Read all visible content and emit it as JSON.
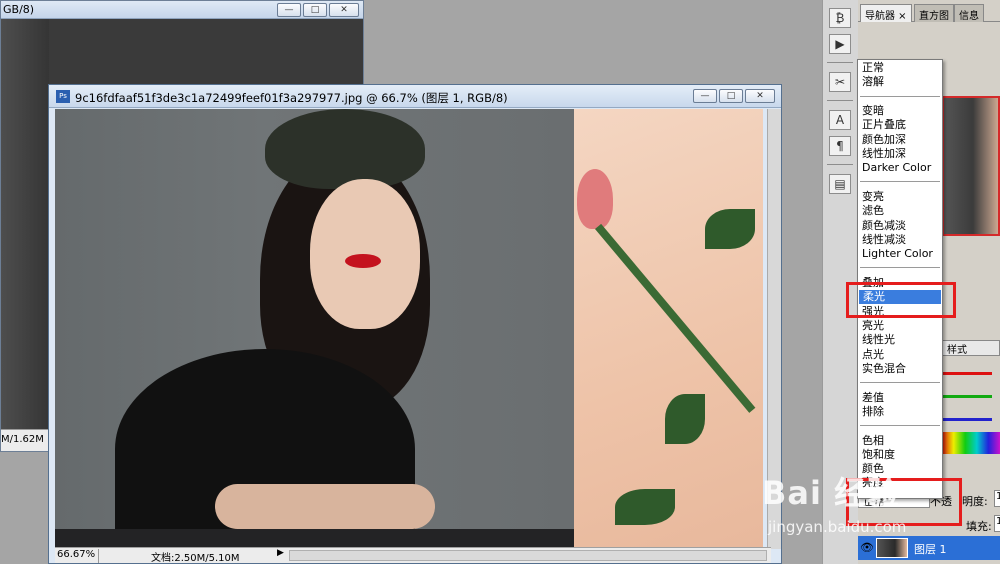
{
  "background_window": {
    "title_fragment": "GB/8)",
    "status_fragment": "M/1.62M"
  },
  "document": {
    "icon_label": "Ps",
    "title": "9c16fdfaaf51f3de3c1a72499feef01f3a297977.jpg @ 66.7% (图层 1, RGB/8)",
    "zoom": "66.67%",
    "doc_size": "文档:2.50M/5.10M"
  },
  "window_buttons": {
    "minimize": "—",
    "maximize": "□",
    "close": "✕"
  },
  "panel": {
    "tabs": [
      {
        "label": "导航器 ×"
      },
      {
        "label": "直方图"
      },
      {
        "label": "信息"
      }
    ],
    "styles_tab": "样式",
    "blend_field": "正常",
    "lock_label": "不透",
    "opacity_label": "明度:",
    "opacity_value": "1",
    "fill_label": "填充:",
    "fill_value": "1",
    "layer_name": "图层 1"
  },
  "blend_menu": {
    "selected": "柔光",
    "groups": [
      [
        "正常",
        "溶解"
      ],
      [
        "变暗",
        "正片叠底",
        "颜色加深",
        "线性加深",
        "Darker Color"
      ],
      [
        "变亮",
        "滤色",
        "颜色减淡",
        "线性减淡",
        "Lighter Color"
      ],
      [
        "叠加",
        "柔光",
        "强光",
        "亮光",
        "线性光",
        "点光",
        "实色混合"
      ],
      [
        "差值",
        "排除"
      ],
      [
        "色相",
        "饱和度",
        "颜色",
        "亮度"
      ]
    ]
  },
  "watermark": {
    "brand": "Bai 经验",
    "url": "jingyan.baidu.com"
  },
  "colors": {
    "highlight": "#e51d1d",
    "selection": "#3a7dde",
    "layer_selected": "#2b6fd6"
  }
}
